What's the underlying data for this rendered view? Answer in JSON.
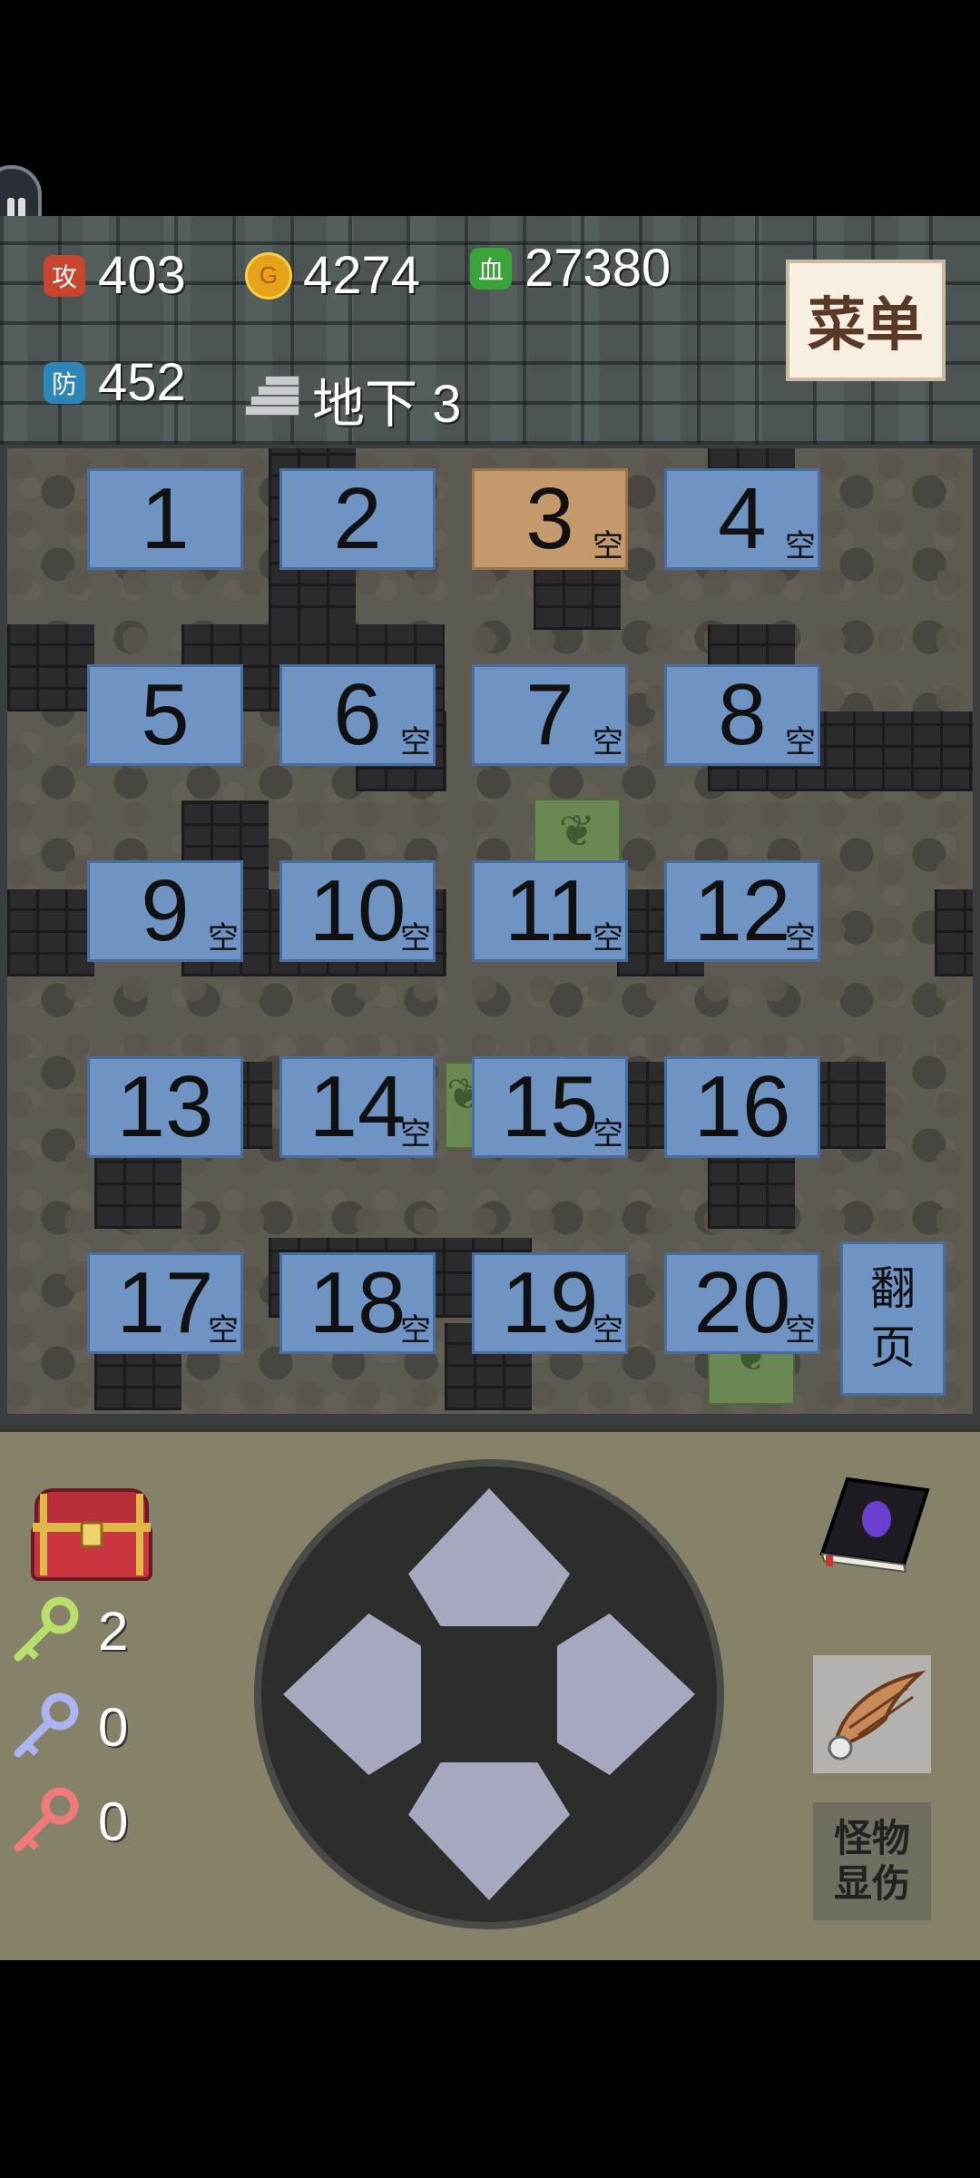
{
  "stats": {
    "attack": {
      "icon_label": "攻",
      "value": "403",
      "color": "#c8462f"
    },
    "gold": {
      "icon_label": "G",
      "value": "4274"
    },
    "hp": {
      "icon_label": "血",
      "value": "27380",
      "color": "#3aa33a"
    },
    "defense": {
      "icon_label": "防",
      "value": "452",
      "color": "#2e86b8"
    },
    "floor": {
      "value": "地下 3"
    }
  },
  "menu_label": "菜单",
  "slots": [
    {
      "num": "1",
      "tag": ""
    },
    {
      "num": "2",
      "tag": ""
    },
    {
      "num": "3",
      "tag": "空",
      "active": true
    },
    {
      "num": "4",
      "tag": "空"
    },
    {
      "num": "5",
      "tag": ""
    },
    {
      "num": "6",
      "tag": "空"
    },
    {
      "num": "7",
      "tag": "空"
    },
    {
      "num": "8",
      "tag": "空"
    },
    {
      "num": "9",
      "tag": "空"
    },
    {
      "num": "10",
      "tag": "空"
    },
    {
      "num": "11",
      "tag": "空"
    },
    {
      "num": "12",
      "tag": "空"
    },
    {
      "num": "13",
      "tag": ""
    },
    {
      "num": "14",
      "tag": "空"
    },
    {
      "num": "15",
      "tag": "空"
    },
    {
      "num": "16",
      "tag": ""
    },
    {
      "num": "17",
      "tag": "空"
    },
    {
      "num": "18",
      "tag": "空"
    },
    {
      "num": "19",
      "tag": "空"
    },
    {
      "num": "20",
      "tag": "空"
    }
  ],
  "page_button": {
    "line1": "翻",
    "line2": "页"
  },
  "keys": {
    "yellow": {
      "count": "2",
      "color": "#b7e06a"
    },
    "blue": {
      "count": "0",
      "color": "#a9b4f0"
    },
    "red": {
      "count": "0",
      "color": "#f07a7a"
    }
  },
  "monster_damage": {
    "line1": "怪物",
    "line2": "显伤"
  },
  "icons": [
    "attack-icon",
    "gold-coin-icon",
    "hp-icon",
    "defense-icon",
    "stairs-icon",
    "chest-icon",
    "key-icon",
    "monster-book-icon",
    "flying-wing-icon",
    "signal-icon",
    "hero-sprite"
  ]
}
